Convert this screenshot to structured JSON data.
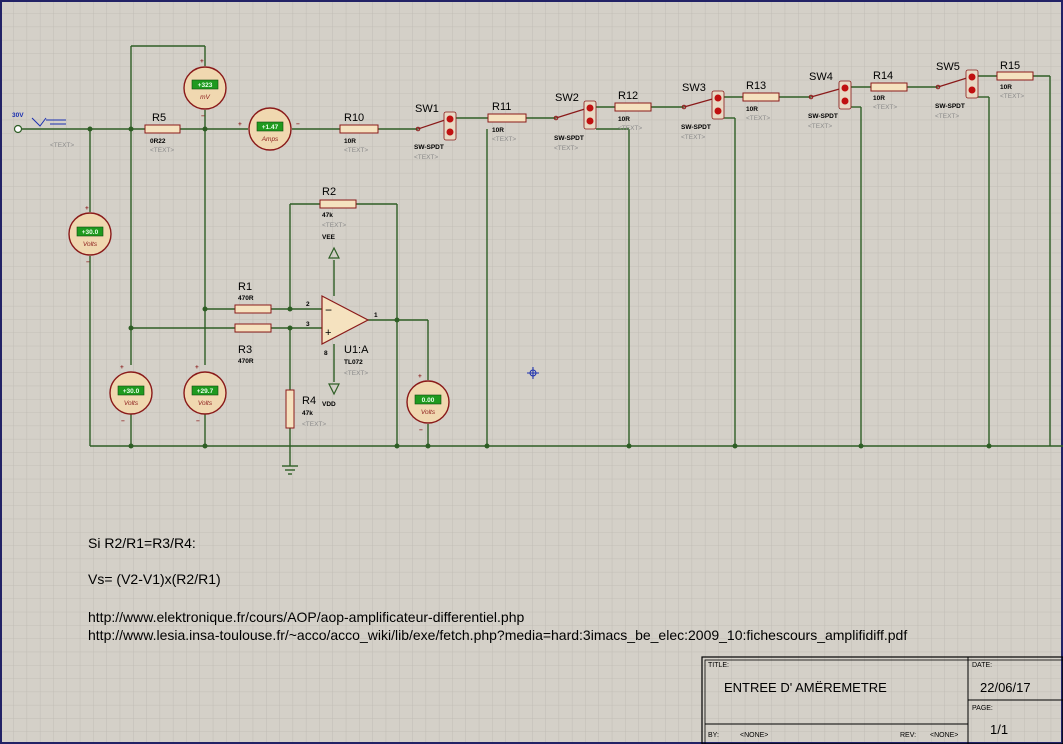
{
  "source": {
    "label": "30V"
  },
  "placeholder_text": "<TEXT>",
  "switch_value": "SW-SPDT",
  "resistors": [
    {
      "ref": "R5",
      "value": "0R22"
    },
    {
      "ref": "R10",
      "value": "10R"
    },
    {
      "ref": "R11",
      "value": "10R"
    },
    {
      "ref": "R12",
      "value": "10R"
    },
    {
      "ref": "R13",
      "value": "10R"
    },
    {
      "ref": "R14",
      "value": "10R"
    },
    {
      "ref": "R15",
      "value": "10R"
    },
    {
      "ref": "R2",
      "value": "47k"
    },
    {
      "ref": "R1",
      "value": "470R"
    },
    {
      "ref": "R3",
      "value": "470R"
    },
    {
      "ref": "R4",
      "value": "47k"
    }
  ],
  "switches": [
    "SW1",
    "SW2",
    "SW3",
    "SW4",
    "SW5"
  ],
  "meters": [
    {
      "reading": "+323",
      "unit": "mV"
    },
    {
      "reading": "+1.47",
      "unit": "Amps"
    },
    {
      "reading": "+30.0",
      "unit": "Volts"
    },
    {
      "reading": "+30.0",
      "unit": "Volts"
    },
    {
      "reading": "+29.7",
      "unit": "Volts"
    },
    {
      "reading": "0.00",
      "unit": "Volts"
    }
  ],
  "opamp": {
    "ref": "U1:A",
    "part": "TL072",
    "pin_inv": "2",
    "pin_noninv": "3",
    "pin_out": "1",
    "pin_supply": "8",
    "vee": "VEE",
    "vdd": "VDD"
  },
  "notes": {
    "line1": "Si R2/R1=R3/R4:",
    "line2": "Vs= (V2-V1)x(R2/R1)",
    "line3": "http://www.elektronique.fr/cours/AOP/aop-amplificateur-differentiel.php",
    "line4": "http://www.lesia.insa-toulouse.fr/~acco/acco_wiki/lib/exe/fetch.php?media=hard:3imacs_be_elec:2009_10:fichescours_amplifidiff.pdf"
  },
  "title_block": {
    "title_label": "TITLE:",
    "title": "ENTREE D' AMËREMETRE",
    "date_label": "DATE:",
    "date": "22/06/17",
    "page_label": "PAGE:",
    "page": "1/1",
    "by_label": "BY:",
    "by": "<NONE>",
    "rev_label": "REV:",
    "rev": "<NONE>"
  },
  "colors": {
    "wire": "#2e5e25",
    "component": "#8a1a1a",
    "lcd": "#1f9a1f",
    "grid": "#bdb9b1",
    "background": "#d4d0c8"
  }
}
